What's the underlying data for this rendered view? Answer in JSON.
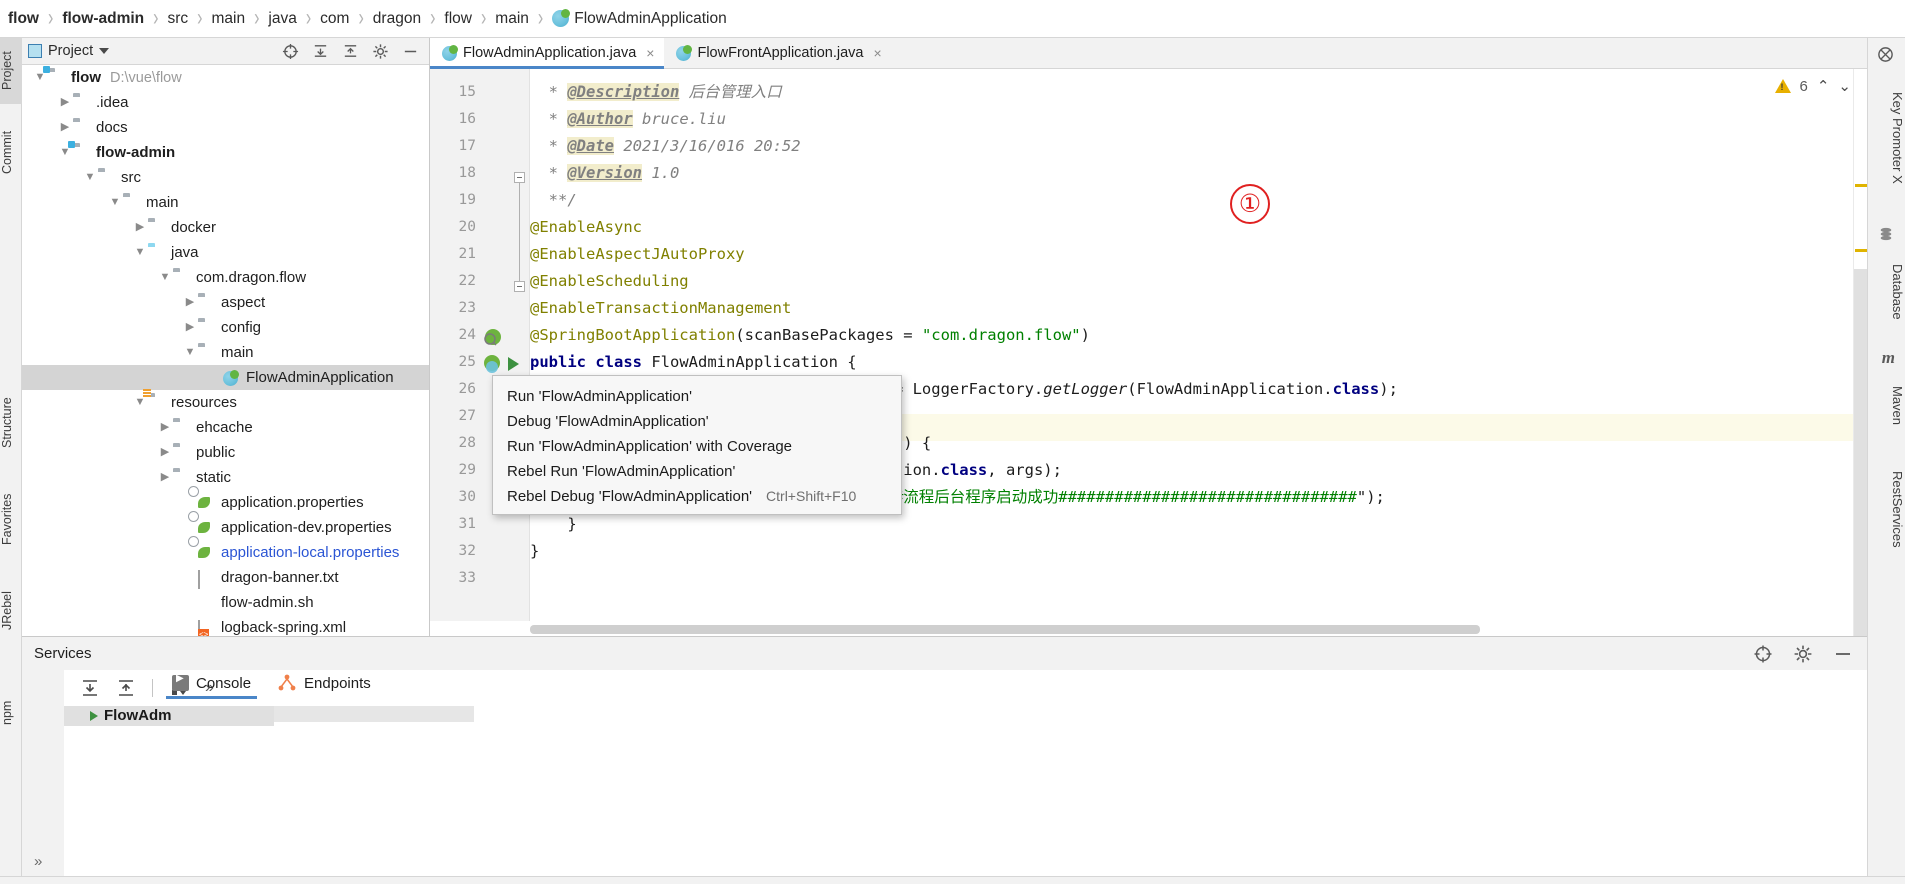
{
  "breadcrumb": {
    "items": [
      {
        "label": "flow",
        "bold": true
      },
      {
        "label": "flow-admin",
        "bold": true
      },
      {
        "label": "src",
        "bold": false
      },
      {
        "label": "main",
        "bold": false
      },
      {
        "label": "java",
        "bold": false
      },
      {
        "label": "com",
        "bold": false
      },
      {
        "label": "dragon",
        "bold": false
      },
      {
        "label": "flow",
        "bold": false
      },
      {
        "label": "main",
        "bold": false
      }
    ],
    "file": "FlowAdminApplication",
    "separator": "›"
  },
  "left_strip": {
    "tabs": [
      {
        "label": "Project",
        "selected": true
      },
      {
        "label": "Commit",
        "selected": false
      },
      {
        "label": "Structure",
        "selected": false
      },
      {
        "label": "Favorites",
        "selected": false
      },
      {
        "label": "JRebel",
        "selected": false
      },
      {
        "label": "npm",
        "selected": false
      }
    ]
  },
  "right_strip": {
    "tabs": [
      {
        "label": "Key Promoter X"
      },
      {
        "label": "Database"
      },
      {
        "label": "Maven"
      },
      {
        "label": "RestServices"
      }
    ]
  },
  "project_panel": {
    "title": "Project",
    "toolbar_icons": [
      "target-icon",
      "expand-all-icon",
      "collapse-all-icon",
      "gear-icon",
      "hide-icon"
    ],
    "tree": [
      {
        "depth": 0,
        "arrow": "down",
        "icon": "folder-module",
        "label": "flow",
        "bold": true,
        "path": "D:\\vue\\flow"
      },
      {
        "depth": 1,
        "arrow": "right",
        "icon": "folder",
        "label": ".idea"
      },
      {
        "depth": 1,
        "arrow": "right",
        "icon": "folder",
        "label": "docs"
      },
      {
        "depth": 1,
        "arrow": "down",
        "icon": "folder-module",
        "label": "flow-admin",
        "bold": true
      },
      {
        "depth": 2,
        "arrow": "down",
        "icon": "folder",
        "label": "src"
      },
      {
        "depth": 3,
        "arrow": "down",
        "icon": "folder",
        "label": "main"
      },
      {
        "depth": 4,
        "arrow": "right",
        "icon": "folder",
        "label": "docker"
      },
      {
        "depth": 4,
        "arrow": "down",
        "icon": "folder-source",
        "label": "java"
      },
      {
        "depth": 5,
        "arrow": "down",
        "icon": "folder-package",
        "label": "com.dragon.flow"
      },
      {
        "depth": 6,
        "arrow": "right",
        "icon": "folder-package",
        "label": "aspect"
      },
      {
        "depth": 6,
        "arrow": "right",
        "icon": "folder-package",
        "label": "config"
      },
      {
        "depth": 6,
        "arrow": "down",
        "icon": "folder-package",
        "label": "main"
      },
      {
        "depth": 7,
        "arrow": "none",
        "icon": "java-class-run",
        "label": "FlowAdminApplication",
        "selected": true
      },
      {
        "depth": 4,
        "arrow": "down",
        "icon": "folder-resources",
        "label": "resources"
      },
      {
        "depth": 5,
        "arrow": "right",
        "icon": "folder",
        "label": "ehcache"
      },
      {
        "depth": 5,
        "arrow": "right",
        "icon": "folder",
        "label": "public"
      },
      {
        "depth": 5,
        "arrow": "right",
        "icon": "folder",
        "label": "static"
      },
      {
        "depth": 6,
        "arrow": "none",
        "icon": "spring-properties",
        "label": "application.properties"
      },
      {
        "depth": 6,
        "arrow": "none",
        "icon": "spring-properties",
        "label": "application-dev.properties"
      },
      {
        "depth": 6,
        "arrow": "none",
        "icon": "spring-properties",
        "label": "application-local.properties",
        "blue": true
      },
      {
        "depth": 6,
        "arrow": "none",
        "icon": "text-file",
        "label": "dragon-banner.txt"
      },
      {
        "depth": 6,
        "arrow": "none",
        "icon": "shell-file",
        "label": "flow-admin.sh"
      },
      {
        "depth": 6,
        "arrow": "none",
        "icon": "xml-file",
        "label": "logback-spring.xml"
      }
    ]
  },
  "editor": {
    "tabs": [
      {
        "label": "FlowAdminApplication.java",
        "active": true,
        "close": "×"
      },
      {
        "label": "FlowFrontApplication.java",
        "active": false,
        "close": "×"
      }
    ],
    "inspection": {
      "warning_count": "6",
      "up": "⌃",
      "down": "⌄"
    },
    "annotation_marker": "①",
    "line_numbers": [
      "15",
      "16",
      "17",
      "18",
      "19",
      "20",
      "21",
      "22",
      "23",
      "24",
      "25",
      "26",
      "27",
      "28",
      "29",
      "30",
      "31",
      "32",
      "33"
    ],
    "lines": [
      {
        "n": "15",
        "segments": [
          {
            "t": "  * ",
            "c": "cmt"
          },
          {
            "t": "@Description",
            "c": "tag"
          },
          {
            "t": " 后台管理入口",
            "c": "cmt"
          }
        ]
      },
      {
        "n": "16",
        "segments": [
          {
            "t": "  * ",
            "c": "cmt"
          },
          {
            "t": "@Author",
            "c": "tag"
          },
          {
            "t": " bruce.liu",
            "c": "cmt"
          }
        ]
      },
      {
        "n": "17",
        "segments": [
          {
            "t": "  * ",
            "c": "cmt"
          },
          {
            "t": "@Date",
            "c": "tag"
          },
          {
            "t": " 2021/3/16/016 20:52",
            "c": "cmt"
          }
        ]
      },
      {
        "n": "18",
        "segments": [
          {
            "t": "  * ",
            "c": "cmt"
          },
          {
            "t": "@Version",
            "c": "tag"
          },
          {
            "t": " 1.0",
            "c": "cmt"
          }
        ]
      },
      {
        "n": "19",
        "segments": [
          {
            "t": "  **/",
            "c": "cmt"
          }
        ]
      },
      {
        "n": "20",
        "segments": [
          {
            "t": "@EnableAsync",
            "c": "ann"
          }
        ]
      },
      {
        "n": "21",
        "segments": [
          {
            "t": "@EnableAspectJAutoProxy",
            "c": "ann"
          }
        ]
      },
      {
        "n": "22",
        "segments": [
          {
            "t": "@EnableScheduling",
            "c": "ann"
          }
        ]
      },
      {
        "n": "23",
        "segments": [
          {
            "t": "@EnableTransactionManagement",
            "c": "ann"
          }
        ]
      },
      {
        "n": "24",
        "segments": [
          {
            "t": "@SpringBootApplication",
            "c": "ann"
          },
          {
            "t": "(",
            "c": "plain"
          },
          {
            "t": "scanBasePackages",
            "c": "plain"
          },
          {
            "t": " = ",
            "c": "plain"
          },
          {
            "t": "\"com.dragon.flow\"",
            "c": "str"
          },
          {
            "t": ")",
            "c": "plain"
          }
        ]
      },
      {
        "n": "25",
        "segments": [
          {
            "t": "public class ",
            "c": "kw"
          },
          {
            "t": "FlowAdminApplication {",
            "c": "plain"
          }
        ]
      },
      {
        "n": "26",
        "segments": [
          {
            "t": "                                       = LoggerFactory.",
            "c": "plain"
          },
          {
            "t": "getLogger",
            "c": "mth"
          },
          {
            "t": "(FlowAdminApplication.",
            "c": "plain"
          },
          {
            "t": "class",
            "c": "kw"
          },
          {
            "t": ");",
            "c": "plain"
          }
        ]
      },
      {
        "n": "27",
        "segments": []
      },
      {
        "n": "28",
        "segments": [
          {
            "t": "                                    args) {",
            "c": "plain"
          }
        ]
      },
      {
        "n": "29",
        "segments": [
          {
            "t": "                               nApplication.",
            "c": "plain"
          },
          {
            "t": "class",
            "c": "kw"
          },
          {
            "t": ", args);",
            "c": "plain"
          }
        ]
      },
      {
        "n": "30",
        "segments": [
          {
            "t": "                              ##########流程后台程序启动成功################################",
            "c": "str"
          },
          {
            "t": "\");",
            "c": "plain"
          }
        ]
      },
      {
        "n": "31",
        "segments": [
          {
            "t": "    }",
            "c": "plain"
          }
        ]
      },
      {
        "n": "32",
        "segments": [
          {
            "t": "}",
            "c": "plain"
          }
        ]
      },
      {
        "n": "33",
        "segments": []
      }
    ]
  },
  "popup": {
    "items": [
      {
        "label": "Run 'FlowAdminApplication'",
        "shortcut": ""
      },
      {
        "label": "Debug 'FlowAdminApplication'",
        "shortcut": ""
      },
      {
        "label": "Run 'FlowAdminApplication' with Coverage",
        "shortcut": ""
      },
      {
        "label": "Rebel Run 'FlowAdminApplication'",
        "shortcut": ""
      },
      {
        "label": "Rebel Debug 'FlowAdminApplication'",
        "shortcut": "Ctrl+Shift+F10"
      }
    ]
  },
  "services": {
    "title": "Services",
    "header_icons": [
      "target-icon",
      "gear-icon",
      "hide-icon"
    ],
    "toolbar_icons": [
      "expand-all-icon",
      "collapse-all-icon",
      "group-icon",
      "more-icon"
    ],
    "tabs": [
      {
        "label": "Console",
        "icon": "console-icon",
        "active": true
      },
      {
        "label": "Endpoints",
        "icon": "endpoints-icon",
        "active": false
      }
    ],
    "tree_node": "FlowAdm",
    "expand_chevron": "»"
  },
  "colors": {
    "accent": "#4a86c8",
    "warning": "#e0b400",
    "annotation": "#e02020",
    "selection": "#d4d4d4",
    "panel": "#f2f2f2",
    "link": "#2b55d4"
  }
}
